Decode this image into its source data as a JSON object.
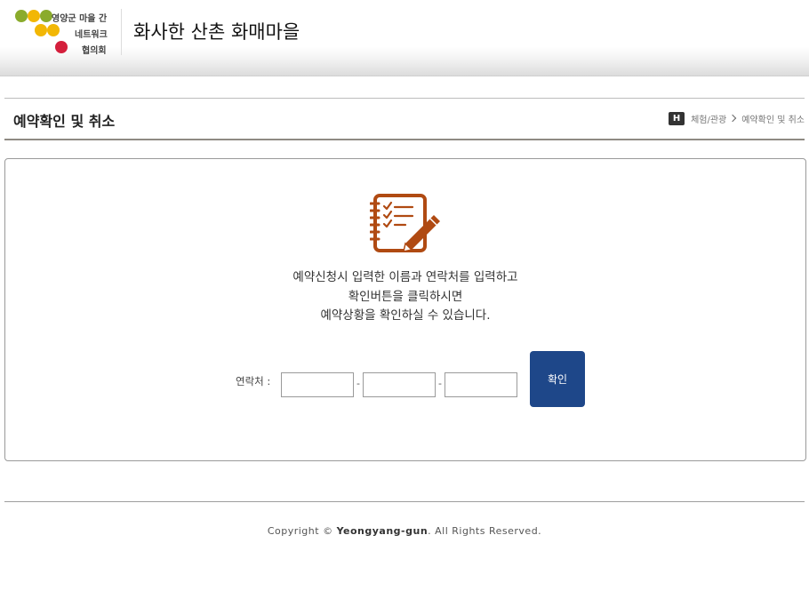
{
  "header": {
    "logo": {
      "line1": "영양군 마을 간",
      "line2": "네트워크",
      "line3": "협의회",
      "colors": {
        "green": "#8aab2c",
        "yellow": "#f2b705",
        "red": "#d41f3c"
      }
    },
    "site_title": "화사한 산촌 화매마을"
  },
  "title_bar": {
    "page_title": "예약확인 및 취소",
    "breadcrumb": {
      "home_glyph": "H",
      "items": [
        "체험/관광",
        "예약확인 및 취소"
      ]
    }
  },
  "main": {
    "icon": "notebook-checklist-pencil-icon",
    "icon_color": "#b04a12",
    "description": [
      "예약신청시 입력한 이름과 연락처를 입력하고",
      "확인버튼을 클릭하시면",
      "예약상황을 확인하실 수 있습니다."
    ],
    "form": {
      "label": "연락처 :",
      "phone_parts": [
        "",
        "",
        ""
      ],
      "separator": "-",
      "confirm_label": "확인",
      "button_color": "#1e4789"
    }
  },
  "footer": {
    "copyright_prefix": "Copyright ©",
    "brand": "Yeongyang-gun",
    "copyright_suffix": ". All Rights Reserved."
  }
}
